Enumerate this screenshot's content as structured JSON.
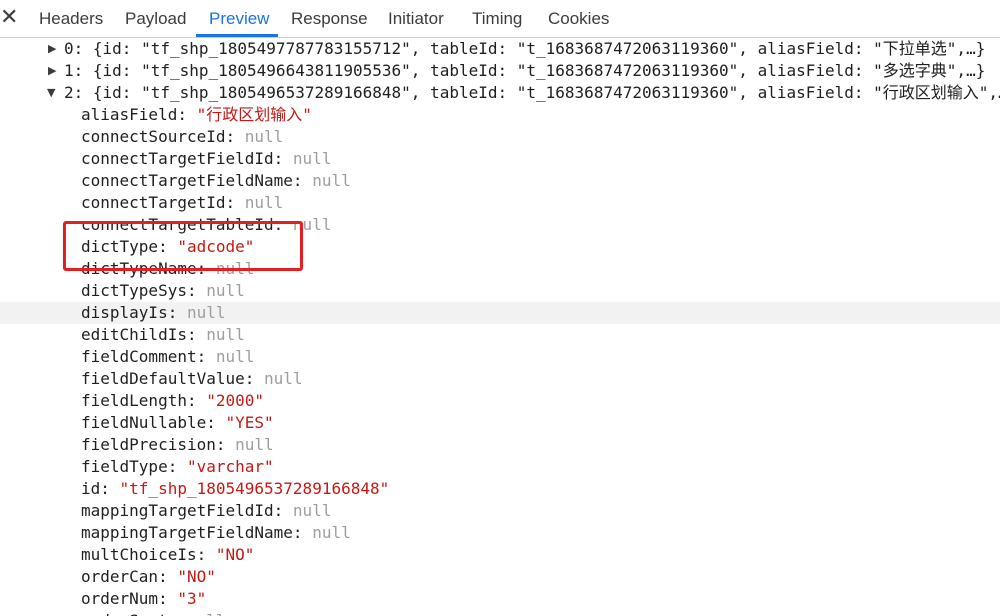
{
  "tabs": [
    {
      "label": "Headers"
    },
    {
      "label": "Payload"
    },
    {
      "label": "Preview"
    },
    {
      "label": "Response"
    },
    {
      "label": "Initiator"
    },
    {
      "label": "Timing"
    },
    {
      "label": "Cookies"
    }
  ],
  "active_tab": "Preview",
  "close_glyph": "✕",
  "collapsed_items": [
    {
      "index": "0",
      "text": "{id: \"tf_shp_1805497787783155712\", tableId: \"t_1683687472063119360\", aliasField: \"下拉单选\",…}"
    },
    {
      "index": "1",
      "text": "{id: \"tf_shp_1805496643811905536\", tableId: \"t_1683687472063119360\", aliasField: \"多选字典\",…}"
    }
  ],
  "expanded_item": {
    "index": "2",
    "text": "{id: \"tf_shp_1805496537289166848\", tableId: \"t_1683687472063119360\", aliasField: \"行政区划输入\",…}"
  },
  "fields": [
    {
      "key": "aliasField",
      "value": "\"行政区划输入\"",
      "kind": "str"
    },
    {
      "key": "connectSourceId",
      "value": "null",
      "kind": "nul"
    },
    {
      "key": "connectTargetFieldId",
      "value": "null",
      "kind": "nul"
    },
    {
      "key": "connectTargetFieldName",
      "value": "null",
      "kind": "nul"
    },
    {
      "key": "connectTargetId",
      "value": "null",
      "kind": "nul"
    },
    {
      "key": "connectTargetTableId",
      "value": "null",
      "kind": "nul"
    },
    {
      "key": "dictType",
      "value": "\"adcode\"",
      "kind": "str"
    },
    {
      "key": "dictTypeName",
      "value": "null",
      "kind": "nul"
    },
    {
      "key": "dictTypeSys",
      "value": "null",
      "kind": "nul"
    },
    {
      "key": "displayIs",
      "value": "null",
      "kind": "nul"
    },
    {
      "key": "editChildIs",
      "value": "null",
      "kind": "nul"
    },
    {
      "key": "fieldComment",
      "value": "null",
      "kind": "nul"
    },
    {
      "key": "fieldDefaultValue",
      "value": "null",
      "kind": "nul"
    },
    {
      "key": "fieldLength",
      "value": "\"2000\"",
      "kind": "str"
    },
    {
      "key": "fieldNullable",
      "value": "\"YES\"",
      "kind": "str"
    },
    {
      "key": "fieldPrecision",
      "value": "null",
      "kind": "nul"
    },
    {
      "key": "fieldType",
      "value": "\"varchar\"",
      "kind": "str"
    },
    {
      "key": "id",
      "value": "\"tf_shp_1805496537289166848\"",
      "kind": "str"
    },
    {
      "key": "mappingTargetFieldId",
      "value": "null",
      "kind": "nul"
    },
    {
      "key": "mappingTargetFieldName",
      "value": "null",
      "kind": "nul"
    },
    {
      "key": "multChoiceIs",
      "value": "\"NO\"",
      "kind": "str"
    },
    {
      "key": "orderCan",
      "value": "\"NO\"",
      "kind": "str"
    },
    {
      "key": "orderNum",
      "value": "\"3\"",
      "kind": "str"
    },
    {
      "key": "orderSort",
      "value": "null",
      "kind": "nul"
    }
  ],
  "highlighted_row_key": "displayIs",
  "annotation_color": "#e32020",
  "accent_color": "#1a73e8"
}
